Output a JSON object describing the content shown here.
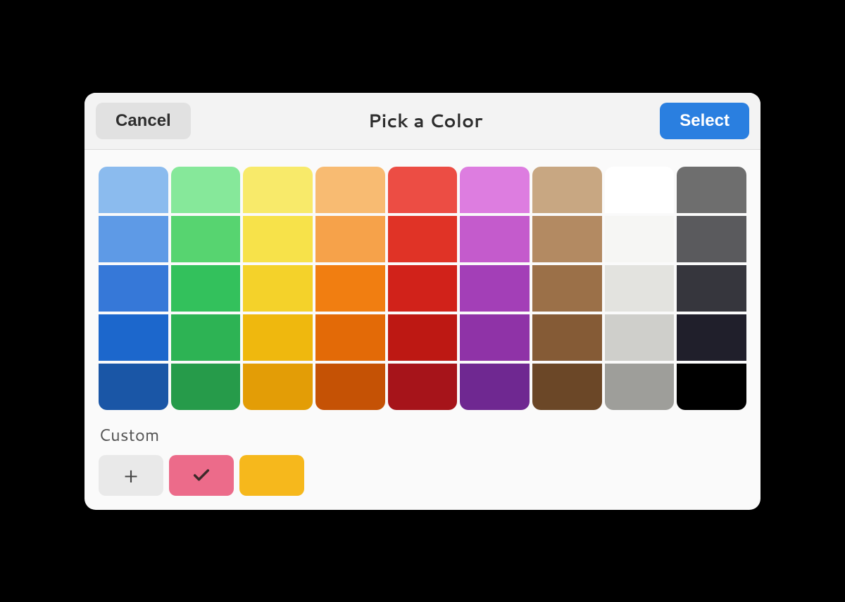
{
  "header": {
    "cancel_label": "Cancel",
    "title": "Pick a Color",
    "select_label": "Select"
  },
  "palette": {
    "columns": [
      [
        "#8bbbee",
        "#5e9ae6",
        "#3678d8",
        "#1c67cc",
        "#1a56a6"
      ],
      [
        "#86e89a",
        "#57d470",
        "#33c15c",
        "#2db354",
        "#269b4a"
      ],
      [
        "#f8ea6a",
        "#f7e24a",
        "#f4d22a",
        "#efb80e",
        "#e39d06"
      ],
      [
        "#f8bb72",
        "#f6a24a",
        "#f17e11",
        "#e36a07",
        "#c55205"
      ],
      [
        "#ec4d44",
        "#e03326",
        "#d1221a",
        "#bd1813",
        "#a6141a"
      ],
      [
        "#dd7de0",
        "#c45bcc",
        "#a33fb7",
        "#8f33a7",
        "#6f2891"
      ],
      [
        "#c8a782",
        "#b38a62",
        "#9b7048",
        "#855b36",
        "#6b4727"
      ],
      [
        "#ffffff",
        "#f6f6f4",
        "#e3e3df",
        "#cfcfcb",
        "#9e9e9a"
      ],
      [
        "#6e6e6e",
        "#5a5a5d",
        "#36363d",
        "#201f2b",
        "#000000"
      ]
    ]
  },
  "custom": {
    "label": "Custom",
    "colors": [
      "#ec6b8a",
      "#f6b81c"
    ],
    "selected_index": 0
  }
}
